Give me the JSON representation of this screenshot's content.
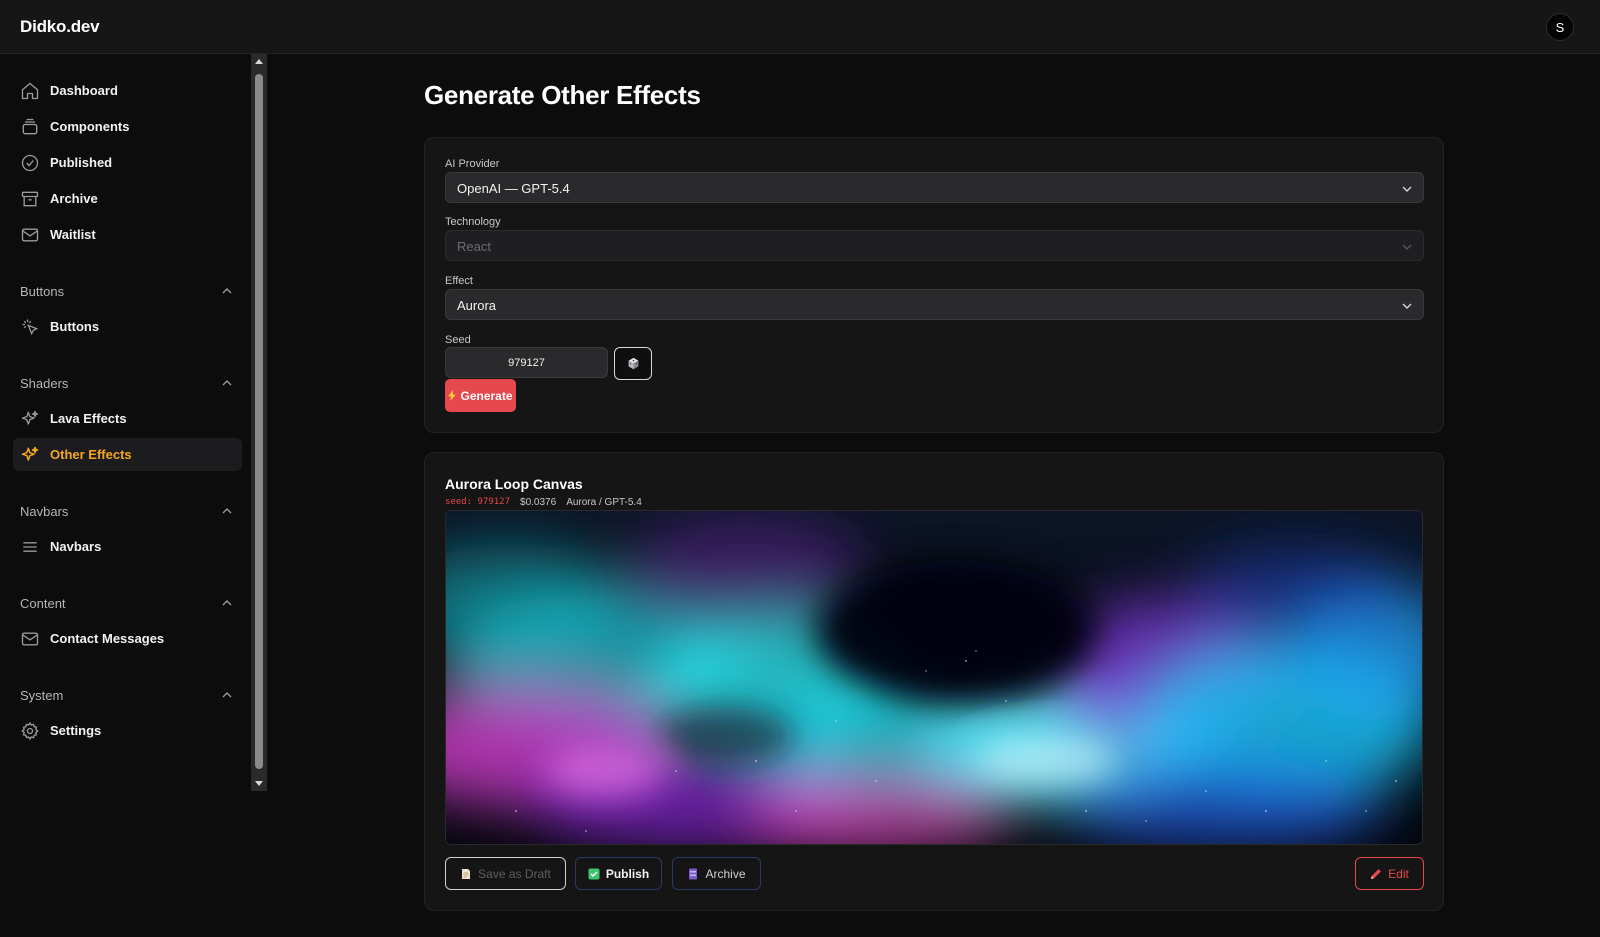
{
  "app": {
    "brand": "Didko.dev",
    "avatar_initial": "S"
  },
  "sidebar": {
    "main_items": [
      {
        "label": "Dashboard",
        "icon": "home-icon"
      },
      {
        "label": "Components",
        "icon": "layers-icon"
      },
      {
        "label": "Published",
        "icon": "check-circle-icon"
      },
      {
        "label": "Archive",
        "icon": "archive-box-icon"
      },
      {
        "label": "Waitlist",
        "icon": "mail-icon"
      }
    ],
    "groups": [
      {
        "title": "Buttons",
        "items": [
          {
            "label": "Buttons",
            "icon": "pointer-click-icon"
          }
        ]
      },
      {
        "title": "Shaders",
        "items": [
          {
            "label": "Lava Effects",
            "icon": "sparkles-icon"
          },
          {
            "label": "Other Effects",
            "icon": "sparkles-icon",
            "active": true
          }
        ]
      },
      {
        "title": "Navbars",
        "items": [
          {
            "label": "Navbars",
            "icon": "menu-lines-icon"
          }
        ]
      },
      {
        "title": "Content",
        "items": [
          {
            "label": "Contact Messages",
            "icon": "mail-icon"
          }
        ]
      },
      {
        "title": "System",
        "items": [
          {
            "label": "Settings",
            "icon": "gear-icon"
          }
        ]
      }
    ]
  },
  "main": {
    "title": "Generate Other Effects",
    "form": {
      "provider_label": "AI Provider",
      "provider_value": "OpenAI — GPT-5.4",
      "technology_label": "Technology",
      "technology_value": "React",
      "effect_label": "Effect",
      "effect_value": "Aurora",
      "seed_label": "Seed",
      "seed_value": "979127",
      "generate_label": "Generate"
    },
    "result": {
      "title": "Aurora Loop Canvas",
      "seed_text": "seed: 979127",
      "cost": "$0.0376",
      "source": "Aurora / GPT-5.4",
      "actions": {
        "save_draft": "Save as Draft",
        "publish": "Publish",
        "archive": "Archive",
        "edit": "Edit"
      }
    }
  },
  "colors": {
    "accent": "#e5484d",
    "active_nav": "#f5a623",
    "background": "#0c0c0d"
  }
}
